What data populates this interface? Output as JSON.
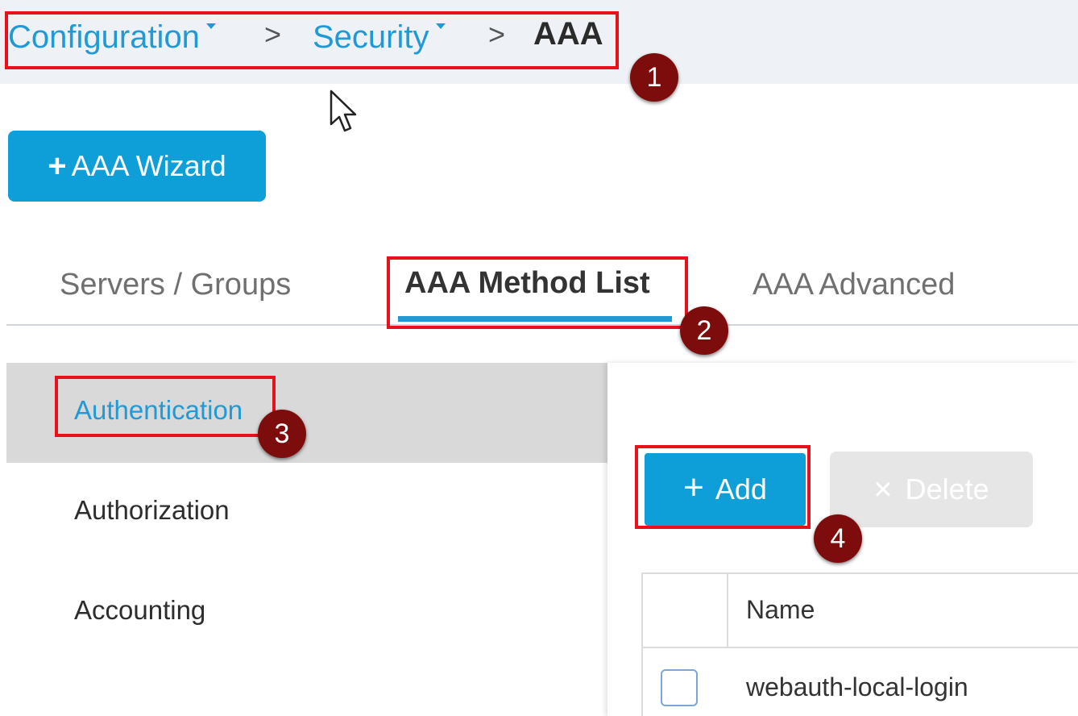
{
  "breadcrumb": {
    "items": [
      "Configuration",
      "Security"
    ],
    "separator": ">",
    "current": "AAA"
  },
  "wizard_button": {
    "plus": "+",
    "label": "AAA Wizard"
  },
  "tabs": [
    {
      "label": "Servers / Groups",
      "active": false
    },
    {
      "label": "AAA Method List",
      "active": true
    },
    {
      "label": "AAA Advanced",
      "active": false
    }
  ],
  "sidebar": {
    "items": [
      {
        "label": "Authentication",
        "active": true
      },
      {
        "label": "Authorization",
        "active": false
      },
      {
        "label": "Accounting",
        "active": false
      }
    ]
  },
  "toolbar": {
    "add_label": "Add",
    "add_icon": "+",
    "delete_label": "Delete",
    "delete_icon": "×"
  },
  "table": {
    "headers": [
      "Name"
    ],
    "rows": [
      {
        "name": "webauth-local-login",
        "checked": false
      }
    ]
  },
  "annotations": [
    "1",
    "2",
    "3",
    "4"
  ],
  "colors": {
    "accent": "#1f9ad6",
    "button": "#0f9fd8",
    "highlight_border": "#e8101a",
    "badge": "#7d0d0d"
  }
}
